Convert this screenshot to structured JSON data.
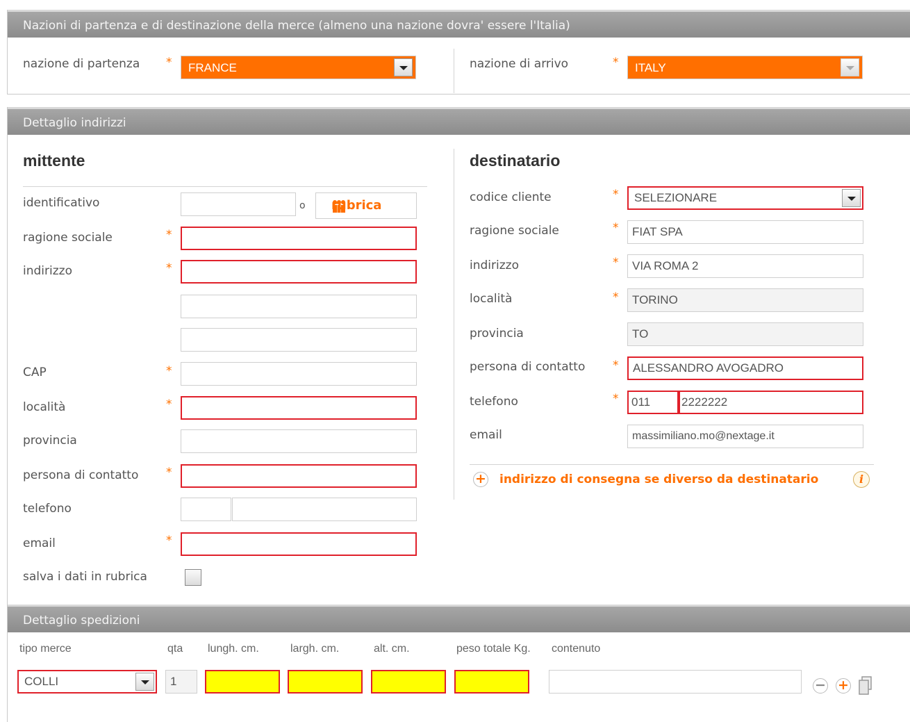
{
  "nations": {
    "header": "Nazioni di partenza e di destinazione della merce (almeno una nazione dovra' essere l'Italia)",
    "departure_label": "nazione di partenza",
    "departure_value": "FRANCE",
    "arrival_label": "nazione di arrivo",
    "arrival_value": "ITALY"
  },
  "addresses": {
    "header": "Dettaglio indirizzi",
    "required_mark": "*",
    "sender": {
      "title": "mittente",
      "id_label": "identificativo",
      "or_text": "o",
      "rubrica_button": "rubrica",
      "company_label": "ragione sociale",
      "address_label": "indirizzo",
      "cap_label": "CAP",
      "city_label": "località",
      "province_label": "provincia",
      "contact_label": "persona di contatto",
      "phone_label": "telefono",
      "email_label": "email",
      "save_label": "salva i dati in rubrica"
    },
    "recipient": {
      "title": "destinatario",
      "client_code_label": "codice cliente",
      "client_code_value": "SELEZIONARE",
      "company_label": "ragione sociale",
      "company_value": "FIAT SPA",
      "address_label": "indirizzo",
      "address_value": "VIA ROMA 2",
      "city_label": "località",
      "city_value": "TORINO",
      "province_label": "provincia",
      "province_value": "TO",
      "contact_label": "persona di contatto",
      "contact_value": "ALESSANDRO AVOGADRO",
      "phone_label": "telefono",
      "phone_prefix": "011",
      "phone_number": "2222222",
      "email_label": "email",
      "email_value": "massimiliano.mo@nextage.it",
      "alt_delivery_link": "indirizzo di consegna se diverso da destinatario"
    }
  },
  "shipments": {
    "header": "Dettaglio spedizioni",
    "columns": [
      "tipo merce",
      "qta",
      "lungh. cm.",
      "largh. cm.",
      "alt. cm.",
      "peso totale Kg.",
      "contenuto"
    ],
    "row": {
      "type_value": "COLLI",
      "qty_value": "1"
    }
  }
}
